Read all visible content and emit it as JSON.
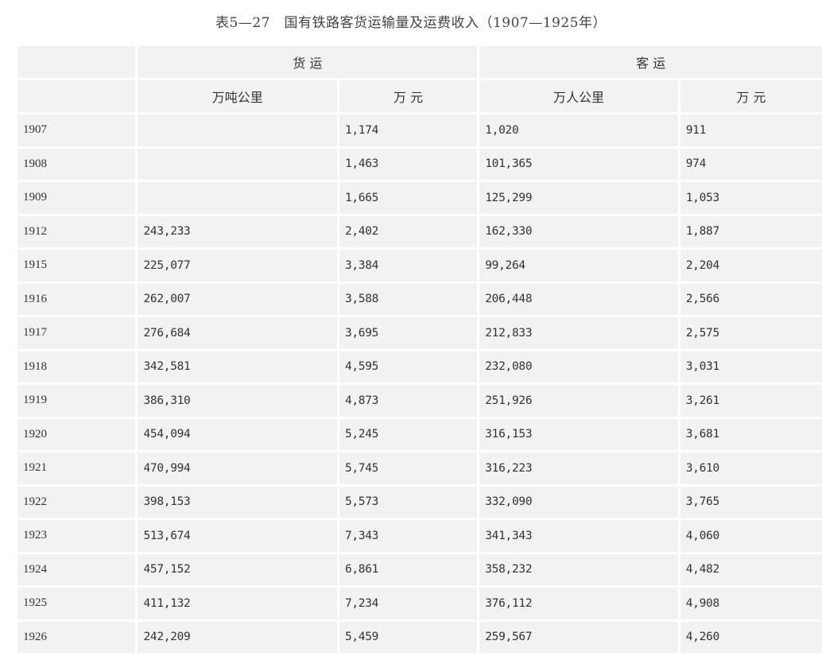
{
  "title": "表5—27　国有铁路客货运输量及运费收入（1907—1925年）",
  "headers": {
    "freight": "货 运",
    "passenger": "客 运",
    "freight_volume_unit": "万吨公里",
    "freight_revenue_unit": "万 元",
    "passenger_volume_unit": "万人公里",
    "passenger_revenue_unit": "万 元"
  },
  "columns": [
    "year",
    "freight_ton_km",
    "freight_revenue",
    "passenger_km",
    "passenger_revenue"
  ],
  "rows": [
    {
      "year": "1907",
      "freight_ton_km": "",
      "freight_revenue": "1,174",
      "passenger_km": "1,020",
      "passenger_revenue": "911"
    },
    {
      "year": "1908",
      "freight_ton_km": "",
      "freight_revenue": "1,463",
      "passenger_km": "101,365",
      "passenger_revenue": "974"
    },
    {
      "year": "1909",
      "freight_ton_km": "",
      "freight_revenue": "1,665",
      "passenger_km": "125,299",
      "passenger_revenue": "1,053"
    },
    {
      "year": "1912",
      "freight_ton_km": "243,233",
      "freight_revenue": "2,402",
      "passenger_km": "162,330",
      "passenger_revenue": "1,887"
    },
    {
      "year": "1915",
      "freight_ton_km": "225,077",
      "freight_revenue": "3,384",
      "passenger_km": "99,264",
      "passenger_revenue": "2,204"
    },
    {
      "year": "1916",
      "freight_ton_km": "262,007",
      "freight_revenue": "3,588",
      "passenger_km": "206,448",
      "passenger_revenue": "2,566"
    },
    {
      "year": "1917",
      "freight_ton_km": "276,684",
      "freight_revenue": "3,695",
      "passenger_km": "212,833",
      "passenger_revenue": "2,575"
    },
    {
      "year": "1918",
      "freight_ton_km": "342,581",
      "freight_revenue": "4,595",
      "passenger_km": "232,080",
      "passenger_revenue": "3,031"
    },
    {
      "year": "1919",
      "freight_ton_km": "386,310",
      "freight_revenue": "4,873",
      "passenger_km": "251,926",
      "passenger_revenue": "3,261"
    },
    {
      "year": "1920",
      "freight_ton_km": "454,094",
      "freight_revenue": "5,245",
      "passenger_km": "316,153",
      "passenger_revenue": "3,681"
    },
    {
      "year": "1921",
      "freight_ton_km": "470,994",
      "freight_revenue": "5,745",
      "passenger_km": "316,223",
      "passenger_revenue": "3,610"
    },
    {
      "year": "1922",
      "freight_ton_km": "398,153",
      "freight_revenue": "5,573",
      "passenger_km": "332,090",
      "passenger_revenue": "3,765"
    },
    {
      "year": "1923",
      "freight_ton_km": "513,674",
      "freight_revenue": "7,343",
      "passenger_km": "341,343",
      "passenger_revenue": "4,060"
    },
    {
      "year": "1924",
      "freight_ton_km": "457,152",
      "freight_revenue": "6,861",
      "passenger_km": "358,232",
      "passenger_revenue": "4,482"
    },
    {
      "year": "1925",
      "freight_ton_km": "411,132",
      "freight_revenue": "7,234",
      "passenger_km": "376,112",
      "passenger_revenue": "4,908"
    },
    {
      "year": "1926",
      "freight_ton_km": "242,209",
      "freight_revenue": "5,459",
      "passenger_km": "259,567",
      "passenger_revenue": "4,260"
    }
  ]
}
